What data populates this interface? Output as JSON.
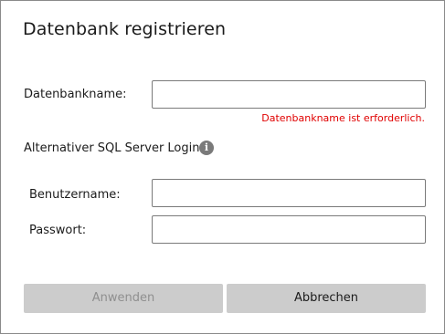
{
  "dialog": {
    "title": "Datenbank registrieren"
  },
  "form": {
    "database_name_label": "Datenbankname:",
    "database_name_value": "",
    "database_name_error": "Datenbankname ist erforderlich.",
    "alt_login_label": "Alternativer SQL Server Login",
    "info_icon_glyph": "i",
    "username_label": "Benutzername:",
    "username_value": "",
    "password_label": "Passwort:",
    "password_value": ""
  },
  "buttons": {
    "apply_label": "Anwenden",
    "apply_enabled": false,
    "cancel_label": "Abbrechen"
  },
  "colors": {
    "error": "#e00000",
    "button_bg": "#cccccc",
    "disabled_text": "#8f8f8f"
  }
}
